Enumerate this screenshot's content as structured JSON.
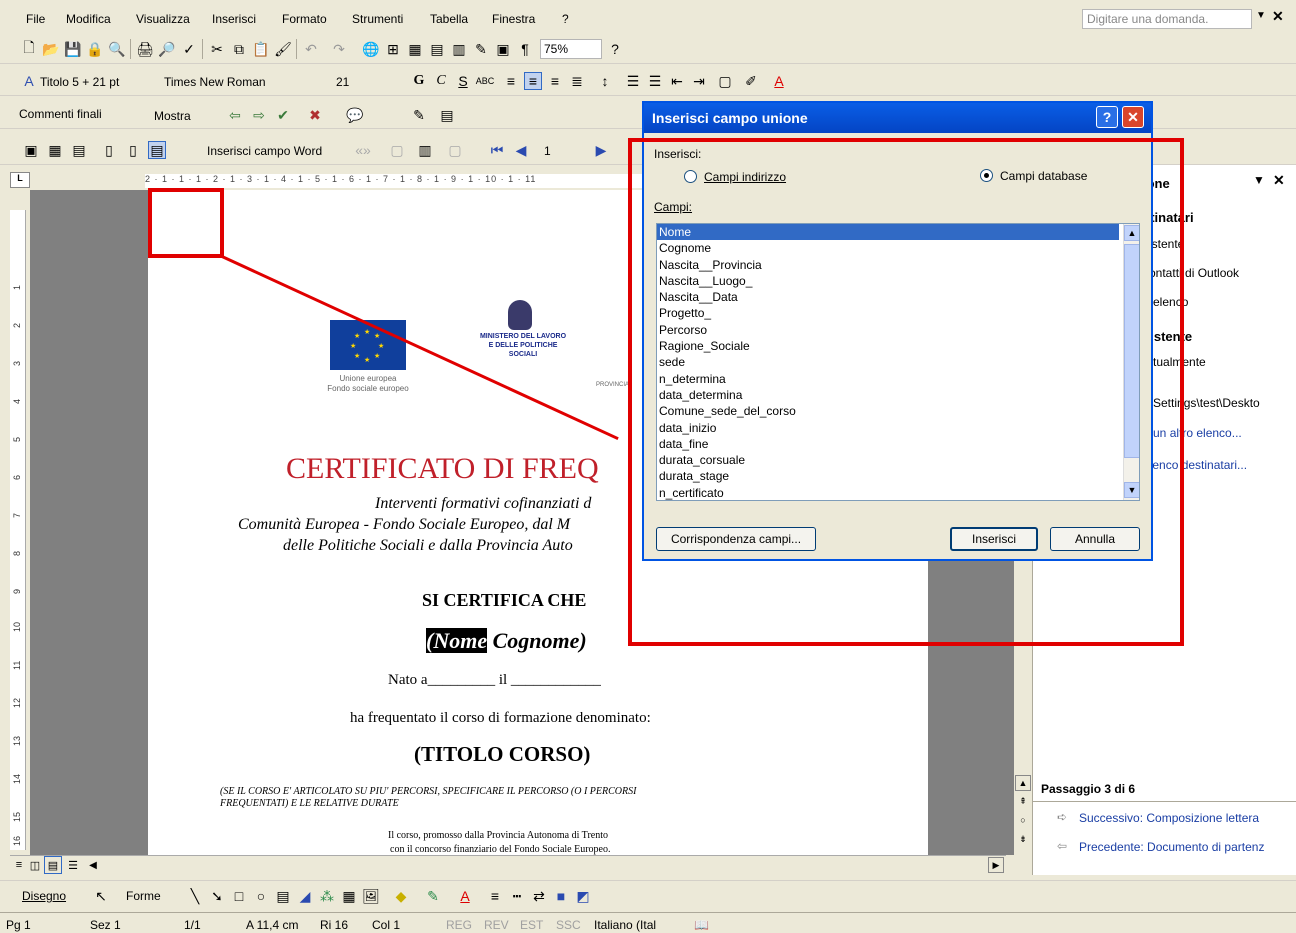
{
  "menubar": {
    "items": [
      "File",
      "Modifica",
      "Visualizza",
      "Inserisci",
      "Formato",
      "Strumenti",
      "Tabella",
      "Finestra",
      "?"
    ],
    "ask_placeholder": "Digitare una domanda."
  },
  "toolbar_standard": {
    "zoom": "75%"
  },
  "toolbar_format": {
    "style": "Titolo 5 + 21 pt",
    "font": "Times New Roman",
    "size": "21"
  },
  "toolbar_review": {
    "comments": "Commenti finali",
    "show": "Mostra"
  },
  "toolbar_mailmerge": {
    "insert_word_field": "Inserisci campo Word",
    "record": "1"
  },
  "ruler_marks": "2 · 1 · 1 · 1 · 2 · 1 · 3 · 1 · 4 · 1 · 5 · 1 · 6 · 1 · 7 · 1 · 8 · 1 · 9 · 1 · 10 · 1 · 11",
  "vruler_marks": [
    "1",
    "2",
    "3",
    "4",
    "5",
    "6",
    "7",
    "8",
    "9",
    "10",
    "11",
    "12",
    "13",
    "14",
    "15",
    "16"
  ],
  "document": {
    "eu_caption": "Unione europea\nFondo sociale europeo",
    "ministry_text": "MINISTERO DEL LAVORO E DELLE POLITICHE SOCIALI",
    "provincia_fragment": "PROVINCIA",
    "title": "CERTIFICATO DI FREQ",
    "line1": "Interventi formativi cofinanziati d",
    "line2": "Comunità Europea - Fondo Sociale Europeo, dal M",
    "line3": "delle Politiche Sociali e dalla Provincia Auto",
    "certifica": "SI CERTIFICA CHE",
    "nome_field": "(Nome",
    "cognome_field": " Cognome)",
    "nato": "Nato a_________ il ____________",
    "frequentato": "ha frequentato il corso di formazione denominato:",
    "titolo_corso": "(TITOLO CORSO)",
    "note_line1": "(SE IL CORSO E' ARTICOLATO SU PIU' PERCORSI, SPECIFICARE IL PERCORSO (O I PERCORSI",
    "note_line2": "FREQUENTATI) E LE RELATIVE DURATE",
    "footer_line1": "Il corso, promosso dalla Provincia Autonoma di Trento",
    "footer_line2": "con il concorso finanziario del Fondo Sociale Europeo."
  },
  "taskpane": {
    "title_fragment": "ione",
    "section1": "stinatari",
    "opt1": "sistente",
    "opt2": "contatti di Outlook",
    "opt3": "o elenco",
    "section2": "sistente",
    "opt4": "attualmente",
    "path": "d Settings\\test\\Deskto",
    "link1": "a un altro elenco...",
    "link2": "elenco destinatari...",
    "step": "Passaggio 3 di 6",
    "next": "Successivo: Composizione lettera",
    "prev": "Precedente: Documento di partenz"
  },
  "dialog": {
    "title": "Inserisci campo unione",
    "insert_label": "Inserisci:",
    "radio_address": "Campi indirizzo",
    "radio_database": "Campi database",
    "fields_label": "Campi:",
    "fields": [
      "Nome",
      "Cognome",
      "Nascita__Provincia",
      "Nascita__Luogo_",
      "Nascita__Data",
      "Progetto_",
      "Percorso",
      "Ragione_Sociale",
      "sede",
      "n_determina",
      "data_determina",
      "Comune_sede_del_corso",
      "data_inizio",
      "data_fine",
      "durata_corsuale",
      "durata_stage",
      "n_certificato"
    ],
    "selected_index": 0,
    "btn_match": "Corrispondenza campi...",
    "btn_insert": "Inserisci",
    "btn_cancel": "Annulla"
  },
  "drawbar": {
    "draw": "Disegno",
    "shapes": "Forme"
  },
  "statusbar": {
    "page": "Pg 1",
    "section": "Sez 1",
    "pages": "1/1",
    "position": "A 11,4 cm",
    "line": "Ri 16",
    "column": "Col 1",
    "rec": "REG",
    "rev": "REV",
    "ext": "EST",
    "ovr": "SSC",
    "language": "Italiano (Ital"
  },
  "colors": {
    "annotation": "#e00000",
    "titlebar": "#0a5ee6",
    "selection": "#316ac5",
    "cert_title": "#c0202a"
  }
}
